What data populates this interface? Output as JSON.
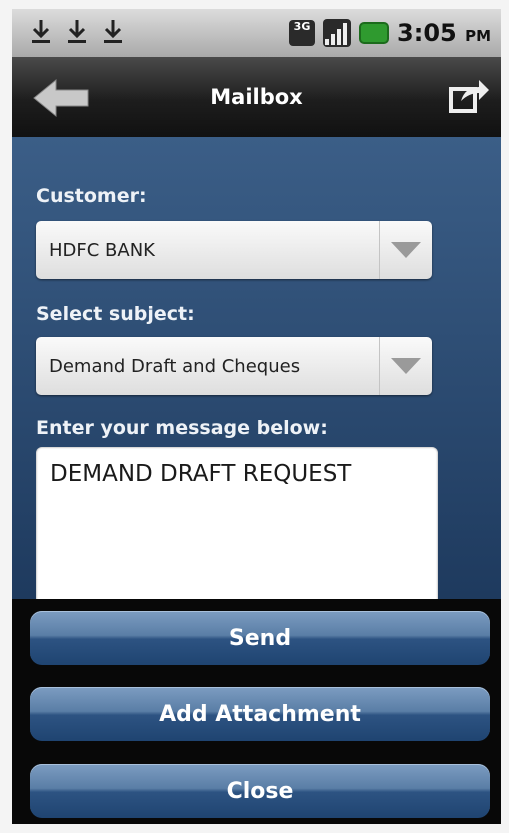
{
  "statusbar": {
    "clock": "3:05",
    "ampm": "PM",
    "network": "3G",
    "icons": [
      "download-icon",
      "download-icon",
      "download-icon",
      "network-3g-icon",
      "signal-icon",
      "battery-icon"
    ]
  },
  "titlebar": {
    "title": "Mailbox",
    "icons": [
      "back-arrow-icon",
      "share-icon"
    ]
  },
  "form": {
    "customer_label": "Customer:",
    "customer_value": "HDFC BANK",
    "subject_label": "Select subject:",
    "subject_value": "Demand Draft and Cheques",
    "message_label": "Enter your message below:",
    "message_value": "DEMAND DRAFT REQUEST"
  },
  "actions": {
    "send": "Send",
    "add_attachment": "Add Attachment",
    "close": "Close"
  },
  "colors": {
    "content_bg": "#2c4b72",
    "button_bg": "#3f6591"
  }
}
